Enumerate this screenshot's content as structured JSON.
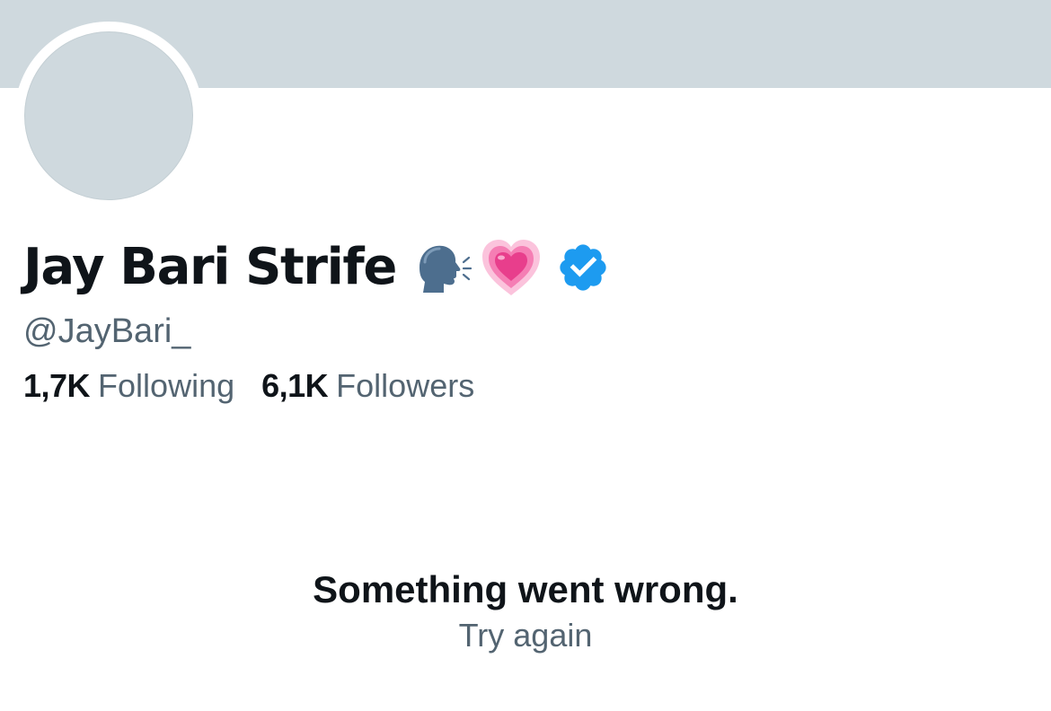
{
  "profile": {
    "display_name": "Jay Bari Strife",
    "handle": "@JayBari_",
    "verified": true,
    "name_emojis": [
      "speaking-head-icon",
      "growing-heart-icon"
    ],
    "banner_color": "#cfd9de",
    "avatar_color": "#cfd9de"
  },
  "stats": {
    "following_count": "1,7K",
    "following_label": "Following",
    "followers_count": "6,1K",
    "followers_label": "Followers"
  },
  "error": {
    "message": "Something went wrong.",
    "retry_label": "Try again"
  },
  "colors": {
    "text_primary": "#0f1419",
    "text_secondary": "#536471",
    "verified_blue": "#1d9bf0",
    "heart_pink": "#f0479a"
  }
}
